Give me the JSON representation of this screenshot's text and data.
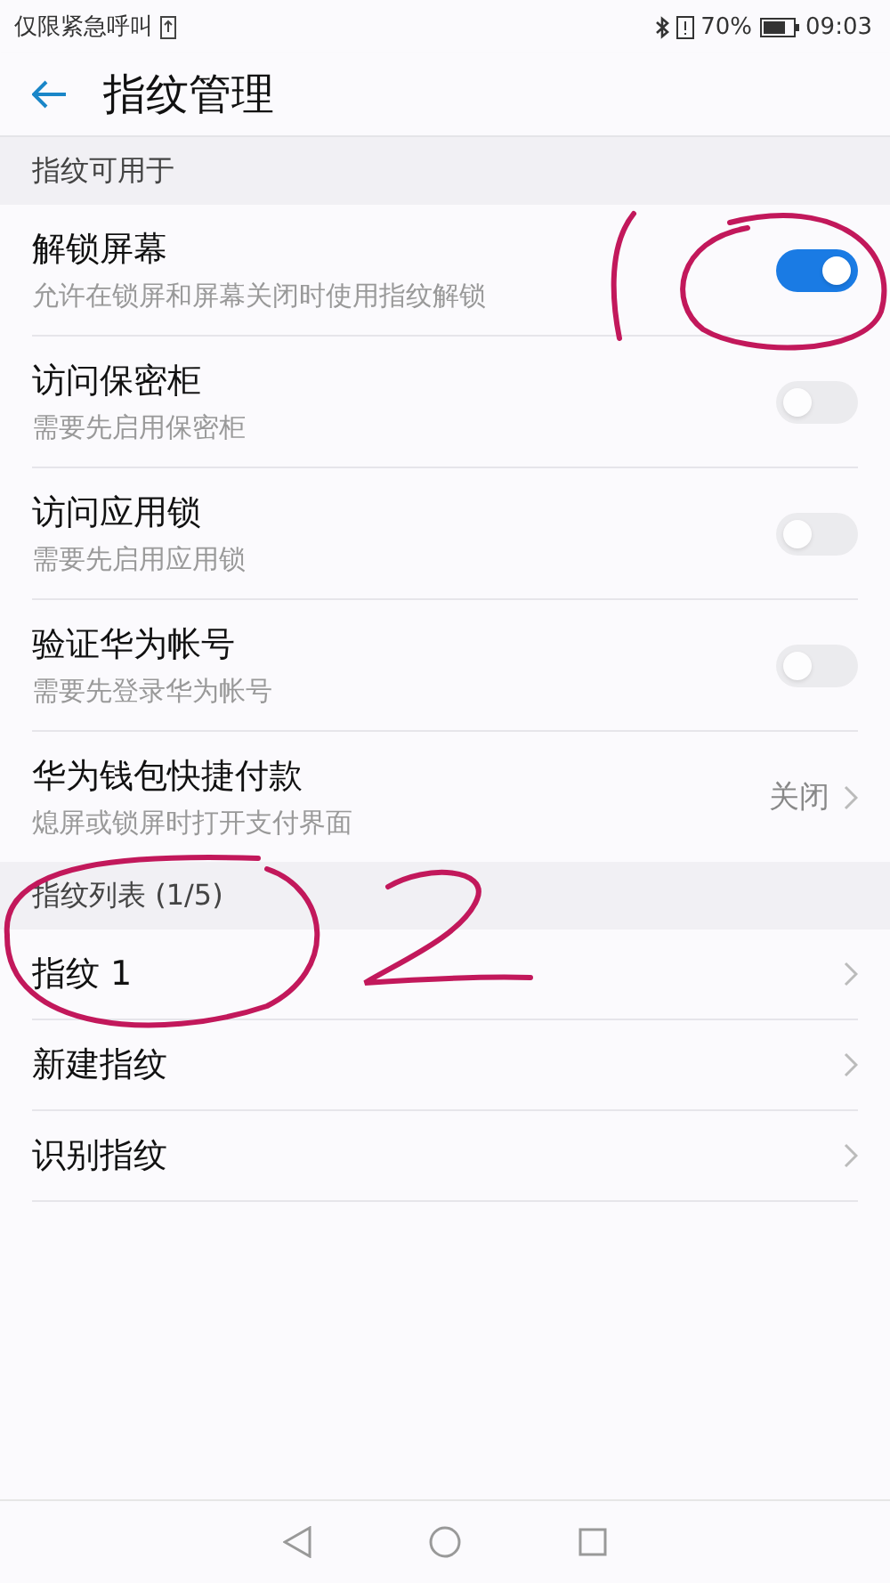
{
  "status_bar": {
    "carrier": "仅限紧急呼叫",
    "battery_percent": "70%",
    "time": "09:03"
  },
  "app_bar": {
    "title": "指纹管理"
  },
  "sections": [
    {
      "header": "指纹可用于",
      "items": [
        {
          "kind": "toggle",
          "title": "解锁屏幕",
          "subtitle": "允许在锁屏和屏幕关闭时使用指纹解锁",
          "on": true,
          "disabled": false
        },
        {
          "kind": "toggle",
          "title": "访问保密柜",
          "subtitle": "需要先启用保密柜",
          "on": false,
          "disabled": true
        },
        {
          "kind": "toggle",
          "title": "访问应用锁",
          "subtitle": "需要先启用应用锁",
          "on": false,
          "disabled": true
        },
        {
          "kind": "toggle",
          "title": "验证华为帐号",
          "subtitle": "需要先登录华为帐号",
          "on": false,
          "disabled": true
        },
        {
          "kind": "value",
          "title": "华为钱包快捷付款",
          "subtitle": "熄屏或锁屏时打开支付界面",
          "value": "关闭"
        }
      ]
    },
    {
      "header": "指纹列表 (1/5)",
      "items": [
        {
          "kind": "link",
          "title": "指纹 1"
        },
        {
          "kind": "link",
          "title": "新建指纹"
        },
        {
          "kind": "link",
          "title": "识别指纹"
        }
      ]
    }
  ]
}
